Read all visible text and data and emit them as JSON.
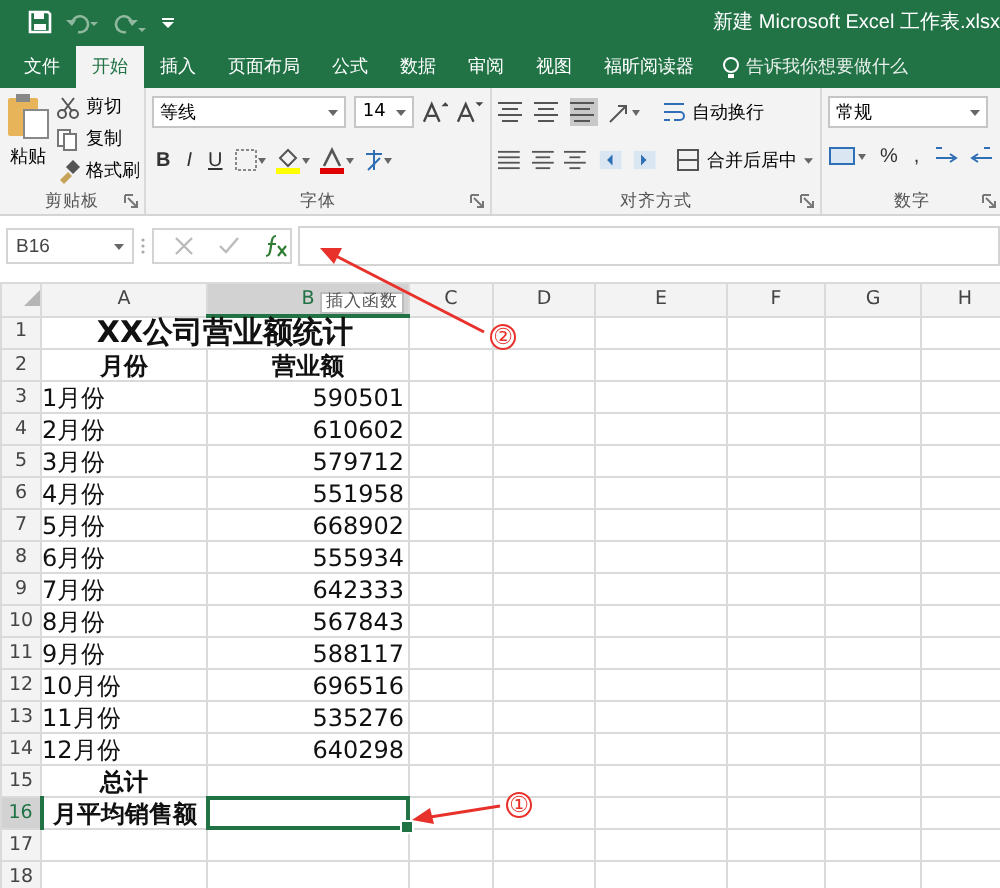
{
  "window": {
    "title": "新建 Microsoft Excel 工作表.xlsx"
  },
  "tabs": [
    {
      "label": "文件",
      "selected": false
    },
    {
      "label": "开始",
      "selected": true
    },
    {
      "label": "插入",
      "selected": false
    },
    {
      "label": "页面布局",
      "selected": false
    },
    {
      "label": "公式",
      "selected": false
    },
    {
      "label": "数据",
      "selected": false
    },
    {
      "label": "审阅",
      "selected": false
    },
    {
      "label": "视图",
      "selected": false
    },
    {
      "label": "福昕阅读器",
      "selected": false
    }
  ],
  "tell_me": {
    "placeholder": "告诉我你想要做什么"
  },
  "ribbon": {
    "clipboard": {
      "paste": "粘贴",
      "cut": "剪切",
      "copy": "复制",
      "format_painter": "格式刷",
      "label": "剪贴板"
    },
    "font": {
      "name": "等线",
      "size": "14",
      "styles": [
        "B",
        "I",
        "U"
      ],
      "label": "字体"
    },
    "alignment": {
      "wrap": "自动换行",
      "merge": "合并后居中",
      "label": "对齐方式"
    },
    "number": {
      "format": "常规",
      "percent": "%",
      "comma": ",",
      "label": "数字"
    }
  },
  "formula_bar": {
    "name_box": "B16",
    "tooltip": "插入函数"
  },
  "columns": [
    {
      "label": "A",
      "selected": false
    },
    {
      "label": "B",
      "selected": true
    },
    {
      "label": "C",
      "selected": false
    },
    {
      "label": "D",
      "selected": false
    },
    {
      "label": "E",
      "selected": false
    },
    {
      "label": "F",
      "selected": false
    },
    {
      "label": "G",
      "selected": false
    },
    {
      "label": "H",
      "selected": false
    }
  ],
  "rows": [
    {
      "num": "1",
      "kind": "title",
      "a": "XX公司营业额统计",
      "selected": false
    },
    {
      "num": "2",
      "kind": "header",
      "a": "月份",
      "b": "营业额",
      "selected": false
    },
    {
      "num": "3",
      "kind": "data",
      "a": "1月份",
      "b": "590501",
      "selected": false
    },
    {
      "num": "4",
      "kind": "data",
      "a": "2月份",
      "b": "610602",
      "selected": false
    },
    {
      "num": "5",
      "kind": "data",
      "a": "3月份",
      "b": "579712",
      "selected": false
    },
    {
      "num": "6",
      "kind": "data",
      "a": "4月份",
      "b": "551958",
      "selected": false
    },
    {
      "num": "7",
      "kind": "data",
      "a": "5月份",
      "b": "668902",
      "selected": false
    },
    {
      "num": "8",
      "kind": "data",
      "a": "6月份",
      "b": "555934",
      "selected": false
    },
    {
      "num": "9",
      "kind": "data",
      "a": "7月份",
      "b": "642333",
      "selected": false
    },
    {
      "num": "10",
      "kind": "data",
      "a": "8月份",
      "b": "567843",
      "selected": false
    },
    {
      "num": "11",
      "kind": "data",
      "a": "9月份",
      "b": "588117",
      "selected": false
    },
    {
      "num": "12",
      "kind": "data",
      "a": "10月份",
      "b": "696516",
      "selected": false
    },
    {
      "num": "13",
      "kind": "data",
      "a": "11月份",
      "b": "535276",
      "selected": false
    },
    {
      "num": "14",
      "kind": "data",
      "a": "12月份",
      "b": "640298",
      "selected": false
    },
    {
      "num": "15",
      "kind": "total",
      "a": "总计",
      "selected": false
    },
    {
      "num": "16",
      "kind": "total",
      "a": "月平均销售额",
      "selected": true
    },
    {
      "num": "17",
      "kind": "empty",
      "selected": false
    },
    {
      "num": "18",
      "kind": "empty",
      "selected": false
    }
  ],
  "annotations": [
    {
      "label": "①"
    },
    {
      "label": "②"
    }
  ]
}
